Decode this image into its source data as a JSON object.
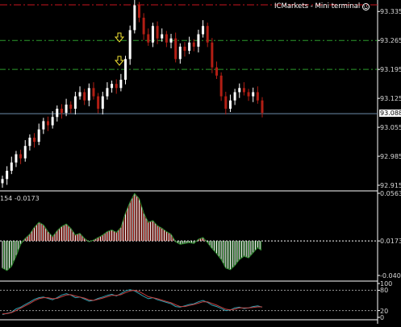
{
  "terminal": {
    "title": "ICMarkets - Mini terminal",
    "icon": "smiley-face-icon"
  },
  "colors": {
    "background": "#000000",
    "bull": "#ffffff",
    "bear": "#b21e14",
    "level_line": "#2c9b2c",
    "top_line": "#c8141e",
    "current_price_line": "#6e8caa",
    "indicator_line": "#2f8a2f",
    "stoch_main": "#2fa0b0",
    "stoch_signal": "#c84040",
    "arrow": "#f2e233"
  },
  "main_axis": {
    "ticks": [
      "93.335",
      "93.265",
      "93.195",
      "93.125",
      "93.055",
      "92.985",
      "92.915"
    ],
    "current_price": "93.088"
  },
  "oscillator": {
    "header": "154 -0.0173",
    "ticks": [
      "0.0563",
      "0.0173",
      "-0.0408"
    ]
  },
  "stochastic": {
    "ticks": [
      "100",
      "80",
      "20",
      "0"
    ]
  },
  "chart_data": [
    {
      "type": "candlestick",
      "title": "",
      "ylim": [
        92.915,
        93.355
      ],
      "current_price": 93.088,
      "horizontal_levels": [
        93.351,
        93.265,
        93.195
      ],
      "close": [
        92.93,
        92.95,
        92.97,
        92.99,
        92.98,
        93.01,
        93.03,
        93.02,
        93.05,
        93.07,
        93.06,
        93.08,
        93.1,
        93.09,
        93.11,
        93.1,
        93.13,
        93.14,
        93.12,
        93.15,
        93.13,
        93.1,
        93.13,
        93.15,
        93.16,
        93.15,
        93.17,
        93.22,
        93.29,
        93.35,
        93.32,
        93.28,
        93.26,
        93.3,
        93.27,
        93.28,
        93.26,
        93.27,
        93.22,
        93.25,
        93.24,
        93.26,
        93.25,
        93.28,
        93.3,
        93.26,
        93.2,
        93.18,
        93.13,
        93.1,
        93.12,
        93.14,
        93.15,
        93.14,
        93.13,
        93.14,
        93.12,
        93.09
      ]
    },
    {
      "type": "histogram",
      "title": "",
      "ylim": [
        -0.0408,
        0.0563
      ],
      "values": [
        -0.032,
        -0.035,
        -0.03,
        -0.018,
        -0.004,
        0.003,
        0.008,
        0.016,
        0.022,
        0.019,
        0.011,
        0.005,
        0.012,
        0.017,
        0.02,
        0.015,
        0.007,
        0.009,
        0.003,
        -0.001,
        0.001,
        0.004,
        0.007,
        0.011,
        0.013,
        0.01,
        0.016,
        0.033,
        0.046,
        0.056,
        0.05,
        0.033,
        0.022,
        0.024,
        0.018,
        0.015,
        0.011,
        0.008,
        -0.001,
        -0.004,
        -0.003,
        -0.002,
        -0.003,
        0.002,
        0.004,
        -0.002,
        -0.009,
        -0.015,
        -0.022,
        -0.032,
        -0.034,
        -0.029,
        -0.022,
        -0.018,
        -0.02,
        -0.014,
        -0.008,
        -0.012
      ]
    },
    {
      "type": "line",
      "title": "",
      "ylim": [
        0,
        100
      ],
      "series": [
        {
          "values": [
            8,
            12,
            15,
            25,
            30,
            38,
            45,
            53,
            58,
            60,
            56,
            52,
            58,
            66,
            70,
            66,
            58,
            60,
            54,
            48,
            50,
            56,
            60,
            65,
            68,
            63,
            70,
            78,
            82,
            78,
            70,
            62,
            55,
            58,
            52,
            48,
            44,
            40,
            32,
            30,
            34,
            38,
            40,
            46,
            50,
            44,
            36,
            32,
            26,
            20,
            22,
            28,
            30,
            26,
            28,
            32,
            34,
            30
          ]
        },
        {
          "values": [
            10,
            11,
            14,
            20,
            27,
            34,
            41,
            49,
            55,
            58,
            58,
            55,
            56,
            61,
            66,
            67,
            63,
            60,
            57,
            52,
            50,
            53,
            57,
            61,
            65,
            65,
            67,
            73,
            78,
            80,
            76,
            69,
            61,
            58,
            55,
            51,
            47,
            43,
            37,
            32,
            32,
            35,
            38,
            42,
            46,
            46,
            41,
            36,
            30,
            24,
            22,
            24,
            28,
            28,
            28,
            29,
            31,
            31
          ]
        }
      ]
    }
  ]
}
